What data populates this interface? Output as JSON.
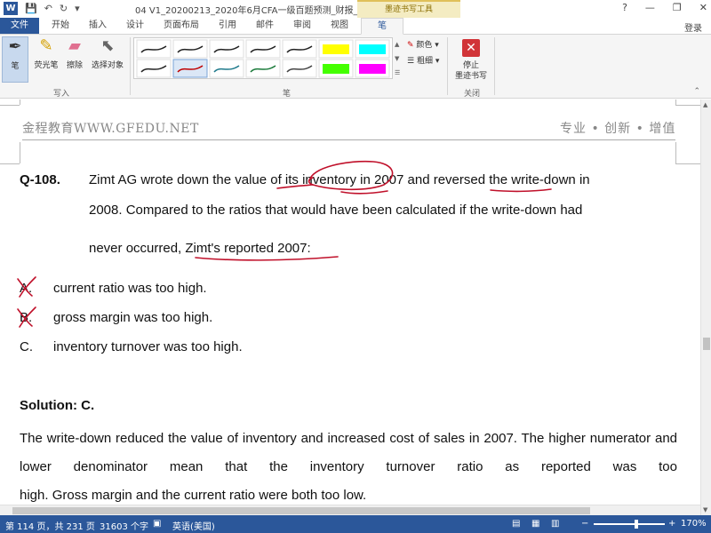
{
  "titlebar": {
    "doc_title": "04 V1_20200213_2020年6月CFA一级百题预测_财报_金程教育...",
    "context_tab": "墨迹书写工具",
    "help": "?",
    "minimize": "—",
    "restore": "❐",
    "close": "✕"
  },
  "tabs": [
    "文件",
    "开始",
    "插入",
    "设计",
    "页面布局",
    "引用",
    "邮件",
    "审阅",
    "视图",
    "笔"
  ],
  "login": "登录",
  "ribbon": {
    "pen_label": "笔",
    "highlighter_label": "荧光笔",
    "eraser_label": "擦除",
    "select_label": "选择对象",
    "group_write": "写入",
    "group_pens": "笔",
    "color_label": "颜色",
    "thickness_label": "粗细",
    "stop_label_1": "停止",
    "stop_label_2": "墨迹书写",
    "group_close": "关闭",
    "pen_colors_row1": [
      "#222222",
      "#222222",
      "#222222",
      "#222222",
      "#222222",
      "#ffff00",
      "#00ffff"
    ],
    "pen_colors_row2": [
      "#222222",
      "#c00000",
      "#1f7a8c",
      "#1a7a3a",
      "#444444",
      "#44ff00",
      "#ff00ff"
    ]
  },
  "doc": {
    "header_left": "金程教育WWW.GFEDU.NET",
    "header_right": "专业 • 创新 • 增值",
    "q_number": "Q-108.",
    "q_line1": "Zimt AG wrote down the value of its inventory in 2007 and reversed the write-down in",
    "q_line2": "2008. Compared to the ratios that would have been calculated if the write-down had",
    "q_line3": "never occurred, Zimt's reported 2007:",
    "options": [
      {
        "letter": "A.",
        "text": "current ratio was too high."
      },
      {
        "letter": "B.",
        "text": "gross margin was too high."
      },
      {
        "letter": "C.",
        "text": "inventory turnover was too high."
      }
    ],
    "solution_heading": "Solution: C.",
    "solution_line1": "The write-down reduced the value of inventory and increased cost of sales in 2007. The higher",
    "solution_line2": "numerator and lower denominator mean that the inventory turnover ratio as reported was too",
    "solution_line3": "high. Gross margin and the current ratio were both too low.",
    "ink_color": "#c0102a"
  },
  "status": {
    "page": "第 114 页，共 231 页",
    "words": "31603 个字",
    "language": "英语(美国)",
    "zoom_minus": "−",
    "zoom_plus": "+",
    "zoom": "170%"
  },
  "colors": {
    "accent": "#2b579a",
    "ribbon_bg": "#f5f5f5",
    "context_tab": "#f4ecc2"
  }
}
